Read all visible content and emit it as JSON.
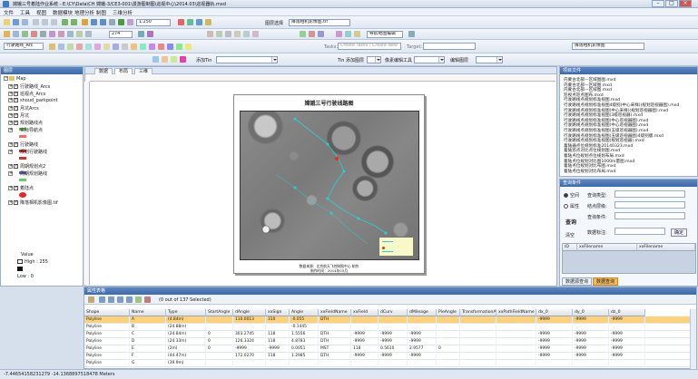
{
  "window": {
    "title": "嫦娥三号着陆作业系统 - E:\\CY\\Data\\CH 嫦娥-3/CE3-001\\漫游图制图\\巡视中心\\2014.03\\巡视器轨.mxd"
  },
  "menu": [
    "文件",
    "工具",
    "视图",
    "数据模块",
    "地理分析",
    "制图",
    "三维分析"
  ],
  "toolbar1": {
    "scale_value": "1:250",
    "layer_combo_label": "图层选择",
    "layer_combo_value": "降落相机影像图.tif"
  },
  "toolbar2": {
    "zoom_value": "274",
    "nav_label": "导航地图编辑"
  },
  "toolbar3": {
    "layer_select_value": "行驶路线_Arc",
    "tasks_label": "Tasks:",
    "tasks_value": "Create Tasks / Create New",
    "target_label": "Target:",
    "target_value": "",
    "right_value": "降落相机影像图",
    "add_label": "添加Tin",
    "tin_label": "Tin 添加图层",
    "edit_label": "像素编辑工具",
    "mode_label": "编辑图层"
  },
  "toc": {
    "header": "图层",
    "root": "Map",
    "layers": [
      {
        "name": "行驶路线_Arcs",
        "checked": true
      },
      {
        "name": "巡视点_Arcs",
        "checked": true
      },
      {
        "name": "shoud_parkpoint",
        "checked": true
      },
      {
        "name": "月坑Arcs",
        "checked": true
      },
      {
        "name": "月坑",
        "checked": true
      },
      {
        "name": "规划路线点",
        "checked": true
      },
      {
        "name": "实际导航点",
        "checked": false
      },
      {
        "name": "行驶路线",
        "checked": true
      },
      {
        "name": "规划行驶路线",
        "checked": false
      },
      {
        "name": "周期规划点2",
        "checked": true
      },
      {
        "name": "周期规划路线",
        "checked": false
      },
      {
        "name": "着陆点",
        "checked": true
      },
      {
        "name": "降落相机影像图.tif",
        "checked": true
      }
    ],
    "raster_value_label": "Value",
    "raster_high": "High : 255",
    "raster_low": "Low : 0"
  },
  "map_view": {
    "tabs": [
      "数据",
      "布局",
      "三维"
    ],
    "map_title": "嫦娥三号行驶线路图",
    "footer_line1": "数据来源：北京航天飞控制图中心 制作",
    "footer_line2": "制作时间：2014年03月"
  },
  "files_panel": {
    "header": "项目文件",
    "files": [
      "内蒙古北部—区域图图.mxd",
      "内蒙古北部—区域图.mxd",
      "内蒙古北部—区域图.mxd",
      "巡视点巡点图布.mxd",
      "行驶路线点规划标准视图.mxd",
      "行驶路线点规划标准视图4级别(中心采样)(规划巡视器图).mxd",
      "行驶路线点规划标准视图(中心采样)(规划巡视器图).mxd",
      "行驶路线点规划标准视图(3级巡视器).mxd",
      "行驶路线点规划标准视图(中心巡视器图).mxd",
      "行驶路线点规划标准视图(中心巡视器图).mxd",
      "行驶路线点规划标准视图(五级巡视器图).mxd",
      "行驶路线点规划标准视图(五级巡视器图)4级别版.mxd",
      "行驶路线点规划标准视图(规划巡视器).mxd",
      "着陆器点位规划标准20140323.mxd",
      "着陆巡点对比点位规划图.mxd",
      "着陆点位规划点位规划布局.mxd",
      "着陆点位规划对比图1000m量图.mxd",
      "着陆点位规划对比布图.mxd",
      "着陆点位规划对比布局.mxd"
    ]
  },
  "query_panel": {
    "header": "查询条件",
    "radio_1": "空间",
    "radio_2": "属性",
    "field_1": "查询类型:",
    "field_2": "结点层级:",
    "field_3": "查询条件:",
    "field_4": "数据标注:",
    "query_button": "查询",
    "clear_button": "清空",
    "ok_button": "确定",
    "col_1": "ID",
    "col_2": "xxFilename",
    "col_3": "xxFilename",
    "tab_1": "数据源查询",
    "tab_2": "数据查询"
  },
  "attr_table": {
    "header": "属性表格",
    "selection_text": "(0 out of 137 Selected)",
    "columns": [
      "Shape",
      "Name",
      "Type",
      "StartAngle",
      "dAngle",
      "xxSign",
      "Angle",
      "xxFieldName",
      "xxField",
      "dCurv",
      "dMileage",
      "PieAngle",
      "TransformationAng",
      "xxPathFieldName",
      "dx_0",
      "dy_0",
      "dz_0"
    ],
    "rows": [
      [
        "Polyline",
        "A",
        "(4.84m)",
        "",
        "110.0013",
        "310",
        "-0.055",
        "DTH",
        "",
        "",
        "",
        "",
        "",
        "",
        "-9999",
        "-9999",
        "-9999"
      ],
      [
        "Polyline",
        "B",
        "(24.88m)",
        "",
        "",
        "",
        "-0.1445",
        "",
        "",
        "",
        "",
        "",
        "",
        "",
        "",
        "",
        ""
      ],
      [
        "Polyline",
        "C",
        "(24.84m)",
        "0",
        "303.2745",
        "118",
        "1.5556",
        "DTH",
        "-9999",
        "-9999",
        "-9999",
        "",
        "",
        "",
        "-9999",
        "-9999",
        "-9999"
      ],
      [
        "Polyline",
        "D",
        "(24.33m)",
        "0",
        "126.3324",
        "118",
        "4.8783",
        "DTH",
        "-9999",
        "-9999",
        "-9999",
        "",
        "",
        "",
        "-9999",
        "-9999",
        "-9999"
      ],
      [
        "Polyline",
        "E",
        "(2m)",
        "0",
        "-9999",
        "-9999",
        "0.0051",
        "MST",
        "118",
        "0.5610",
        "2.9577",
        "0",
        "",
        "",
        "-9999",
        "-9999",
        "-9999"
      ],
      [
        "Polyline",
        "F",
        "(44.47m)",
        "",
        "172.0270",
        "118",
        "1.2985",
        "DTH",
        "-9999",
        "-9999",
        "-9999",
        "",
        "",
        "",
        "-9999",
        "-9999",
        "-9999"
      ],
      [
        "Polyline",
        "G",
        "(39.9m)",
        "",
        "",
        "",
        "",
        "",
        "",
        "",
        "",
        "",
        "",
        "",
        "",
        "",
        ""
      ]
    ]
  },
  "status": {
    "coords": "-7.44654158231279 -14.1368897518478 Meters"
  },
  "colors": {
    "panel_header": "#4a77b8",
    "selected_row": "#ffd27a",
    "route_marker": "#2ecfd0",
    "warning_marker": "#e03020"
  }
}
